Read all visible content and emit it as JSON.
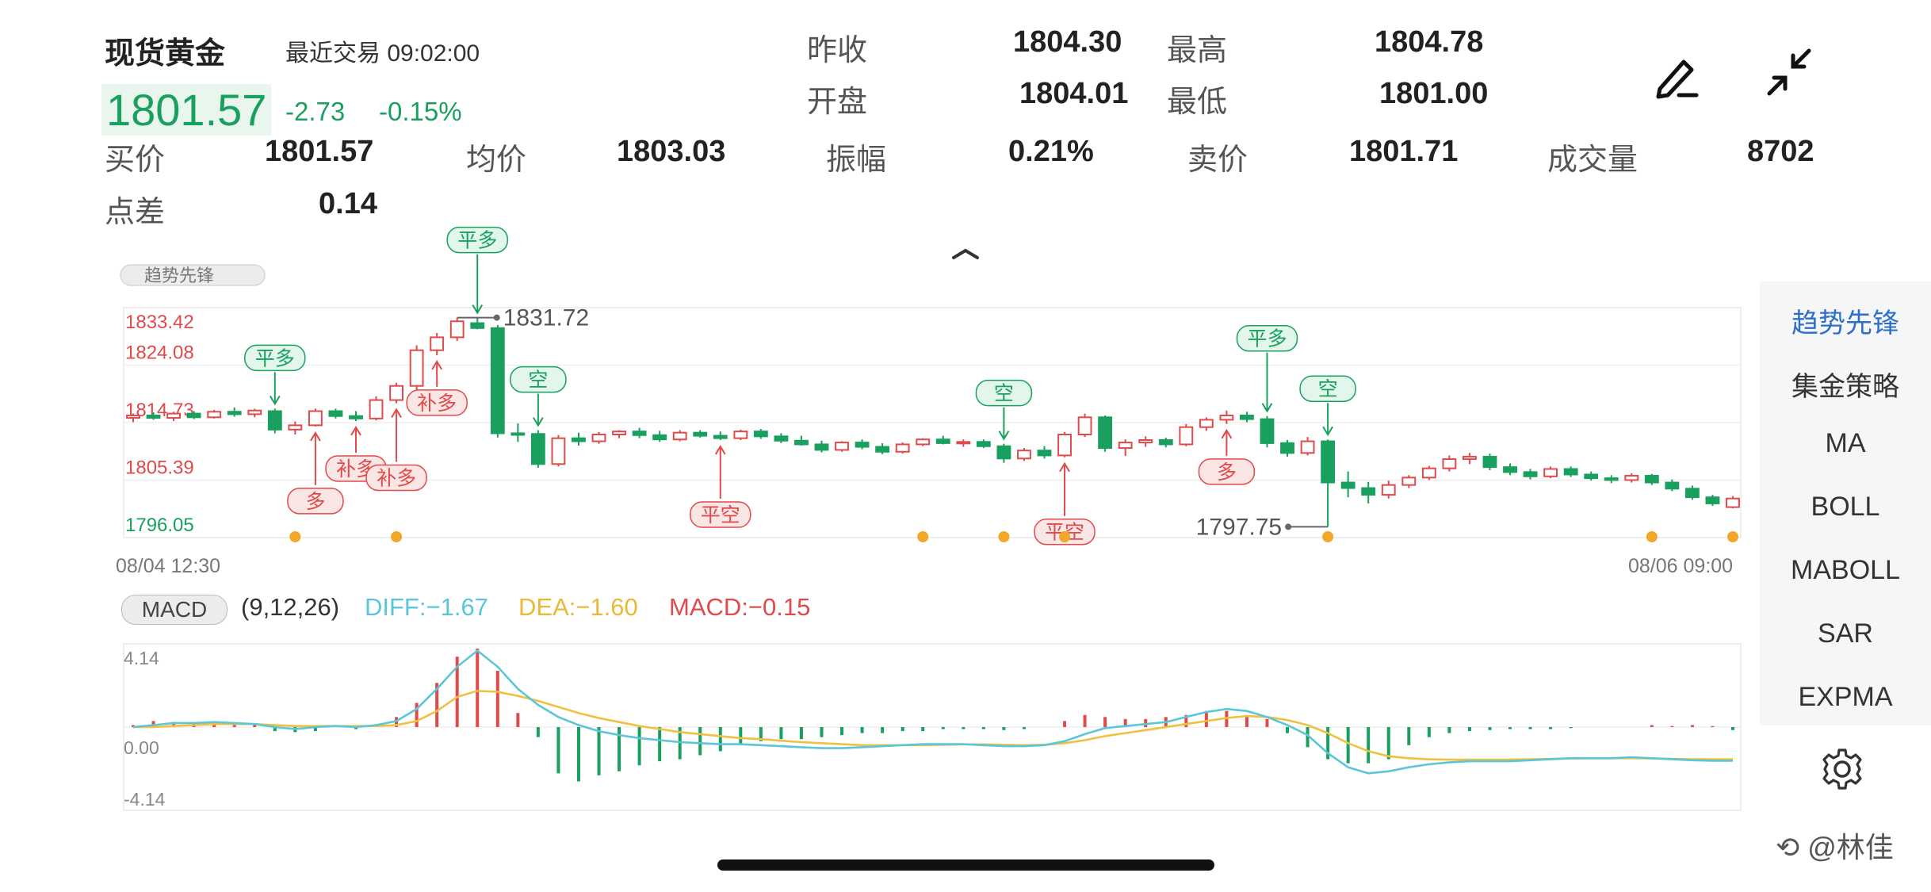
{
  "header": {
    "title": "现货黄金",
    "last_trade": "最近交易 09:02:00",
    "price": "1801.57",
    "change": "-2.73",
    "change_pct": "-0.15%",
    "prev_close_label": "昨收",
    "prev_close": "1804.30",
    "high_label": "最高",
    "high": "1804.78",
    "open_label": "开盘",
    "open": "1804.01",
    "low_label": "最低",
    "low": "1801.00",
    "bid_label": "买价",
    "bid": "1801.57",
    "avg_label": "均价",
    "avg": "1803.03",
    "amp_label": "振幅",
    "amp": "0.21%",
    "ask_label": "卖价",
    "ask": "1801.71",
    "volume_label": "成交量",
    "volume": "8702",
    "spread_label": "点差",
    "spread": "0.14"
  },
  "sidebar": {
    "items": [
      "趋势先锋",
      "集金策略",
      "MA",
      "BOLL",
      "MABOLL",
      "SAR",
      "EXPMA"
    ],
    "active_index": 0
  },
  "macd": {
    "pill": "MACD",
    "params": "(9,12,26)",
    "diff": "DIFF:−1.67",
    "dea": "DEA:−1.60",
    "macd": "MACD:−0.15"
  },
  "watermark": "@林佳",
  "colors": {
    "up": "#e04a4a",
    "down": "#1aa05e",
    "diff": "#5bc6d8",
    "dea": "#f0c040",
    "dot": "#f2a62a"
  },
  "chart_data": [
    {
      "type": "candlestick",
      "ylim": [
        1796.05,
        1833.42
      ],
      "ytick_labels": [
        "1833.42",
        "1824.08",
        "1814.73",
        "1805.39",
        "1796.05"
      ],
      "x_start_label": "08/04 12:30",
      "x_end_label": "08/06 09:00",
      "legend_tag": "趋势先锋",
      "max_label": "1831.72",
      "min_label": "1797.75",
      "candles": [
        [
          1815.5,
          1816.2,
          1814.8,
          1815.9
        ],
        [
          1815.9,
          1816.4,
          1815.2,
          1815.5
        ],
        [
          1815.5,
          1816.5,
          1815.0,
          1816.2
        ],
        [
          1816.2,
          1816.6,
          1815.3,
          1815.6
        ],
        [
          1815.6,
          1816.8,
          1815.4,
          1816.5
        ],
        [
          1816.5,
          1817.2,
          1815.7,
          1816.1
        ],
        [
          1816.1,
          1817.0,
          1815.6,
          1816.7
        ],
        [
          1816.6,
          1817.0,
          1813.0,
          1813.6
        ],
        [
          1813.6,
          1814.9,
          1812.8,
          1814.3
        ],
        [
          1814.3,
          1817.0,
          1814.1,
          1816.6
        ],
        [
          1816.6,
          1817.0,
          1815.4,
          1815.8
        ],
        [
          1815.8,
          1816.6,
          1815.0,
          1815.4
        ],
        [
          1815.4,
          1819.0,
          1815.1,
          1818.4
        ],
        [
          1818.4,
          1821.2,
          1817.9,
          1820.7
        ],
        [
          1820.7,
          1827.3,
          1820.0,
          1826.5
        ],
        [
          1826.5,
          1829.3,
          1825.7,
          1828.6
        ],
        [
          1828.6,
          1831.8,
          1828.0,
          1831.2
        ],
        [
          1830.9,
          1831.8,
          1829.9,
          1830.1
        ],
        [
          1830.1,
          1830.6,
          1812.3,
          1813.0
        ],
        [
          1813.0,
          1814.6,
          1811.6,
          1812.9
        ],
        [
          1812.9,
          1813.5,
          1807.4,
          1808.0
        ],
        [
          1808.0,
          1812.7,
          1807.6,
          1812.2
        ],
        [
          1812.2,
          1813.1,
          1811.0,
          1811.7
        ],
        [
          1811.7,
          1813.2,
          1811.3,
          1812.8
        ],
        [
          1812.8,
          1813.5,
          1812.2,
          1813.3
        ],
        [
          1813.3,
          1813.9,
          1812.2,
          1812.7
        ],
        [
          1812.7,
          1813.4,
          1811.6,
          1812.0
        ],
        [
          1812.0,
          1813.5,
          1811.7,
          1813.1
        ],
        [
          1813.1,
          1813.5,
          1812.3,
          1812.6
        ],
        [
          1812.6,
          1813.3,
          1811.9,
          1812.2
        ],
        [
          1812.2,
          1813.6,
          1811.9,
          1813.3
        ],
        [
          1813.3,
          1813.7,
          1812.1,
          1812.5
        ],
        [
          1812.5,
          1813.0,
          1811.4,
          1811.8
        ],
        [
          1811.8,
          1812.6,
          1811.0,
          1811.2
        ],
        [
          1811.2,
          1811.8,
          1809.9,
          1810.3
        ],
        [
          1810.3,
          1811.7,
          1810.0,
          1811.5
        ],
        [
          1811.5,
          1812.0,
          1810.4,
          1810.8
        ],
        [
          1810.8,
          1811.4,
          1809.6,
          1810.0
        ],
        [
          1810.0,
          1811.5,
          1809.7,
          1811.2
        ],
        [
          1811.2,
          1812.2,
          1810.9,
          1812.0
        ],
        [
          1812.0,
          1812.6,
          1811.2,
          1811.4
        ],
        [
          1811.4,
          1812.0,
          1810.8,
          1811.6
        ],
        [
          1811.6,
          1812.0,
          1810.6,
          1810.9
        ],
        [
          1810.9,
          1811.3,
          1808.2,
          1808.9
        ],
        [
          1808.9,
          1810.6,
          1808.5,
          1810.2
        ],
        [
          1810.2,
          1810.9,
          1808.9,
          1809.4
        ],
        [
          1809.4,
          1813.2,
          1809.1,
          1812.8
        ],
        [
          1812.8,
          1816.2,
          1812.4,
          1815.6
        ],
        [
          1815.6,
          1815.9,
          1810.0,
          1810.6
        ],
        [
          1810.6,
          1812.0,
          1809.3,
          1811.5
        ],
        [
          1811.5,
          1812.5,
          1810.8,
          1811.9
        ],
        [
          1811.9,
          1812.3,
          1810.7,
          1811.2
        ],
        [
          1811.2,
          1814.5,
          1810.9,
          1814.0
        ],
        [
          1814.0,
          1815.6,
          1813.4,
          1815.2
        ],
        [
          1815.2,
          1816.7,
          1814.5,
          1815.9
        ],
        [
          1815.9,
          1816.5,
          1814.8,
          1815.3
        ],
        [
          1815.3,
          1815.8,
          1810.7,
          1811.4
        ],
        [
          1811.4,
          1811.9,
          1809.2,
          1809.8
        ],
        [
          1809.8,
          1812.4,
          1809.4,
          1811.7
        ],
        [
          1811.7,
          1812.0,
          1797.8,
          1805.0
        ],
        [
          1805.0,
          1806.8,
          1802.6,
          1804.1
        ],
        [
          1804.1,
          1805.1,
          1801.6,
          1803.0
        ],
        [
          1803.0,
          1805.3,
          1802.4,
          1804.6
        ],
        [
          1804.6,
          1806.2,
          1804.1,
          1805.8
        ],
        [
          1805.8,
          1807.7,
          1805.4,
          1807.3
        ],
        [
          1807.3,
          1809.4,
          1806.8,
          1808.8
        ],
        [
          1808.8,
          1809.8,
          1808.0,
          1809.2
        ],
        [
          1809.2,
          1809.7,
          1807.0,
          1807.5
        ],
        [
          1807.5,
          1808.1,
          1806.2,
          1806.7
        ],
        [
          1806.7,
          1807.2,
          1805.5,
          1806.0
        ],
        [
          1806.0,
          1807.6,
          1805.7,
          1807.2
        ],
        [
          1807.2,
          1807.6,
          1805.9,
          1806.3
        ],
        [
          1806.3,
          1806.8,
          1805.3,
          1805.7
        ],
        [
          1805.7,
          1806.2,
          1804.9,
          1805.4
        ],
        [
          1805.4,
          1806.5,
          1805.0,
          1806.1
        ],
        [
          1806.1,
          1806.4,
          1804.6,
          1805.0
        ],
        [
          1805.0,
          1805.5,
          1803.6,
          1804.0
        ],
        [
          1804.0,
          1804.5,
          1802.2,
          1802.6
        ],
        [
          1802.6,
          1803.0,
          1801.2,
          1801.6
        ],
        [
          1801.0,
          1802.8,
          1800.8,
          1802.4
        ]
      ],
      "signals": [
        {
          "label": "平多",
          "index": 7,
          "kind": "close"
        },
        {
          "label": "多",
          "index": 9,
          "kind": "open"
        },
        {
          "label": "补多",
          "index": 11,
          "kind": "open"
        },
        {
          "label": "补多",
          "index": 13,
          "kind": "open"
        },
        {
          "label": "补多",
          "index": 15,
          "kind": "open"
        },
        {
          "label": "平多",
          "index": 17,
          "kind": "close"
        },
        {
          "label": "空",
          "index": 20,
          "kind": "close"
        },
        {
          "label": "平空",
          "index": 29,
          "kind": "open"
        },
        {
          "label": "空",
          "index": 43,
          "kind": "close"
        },
        {
          "label": "平空",
          "index": 46,
          "kind": "open"
        },
        {
          "label": "多",
          "index": 54,
          "kind": "open"
        },
        {
          "label": "平多",
          "index": 56,
          "kind": "close"
        },
        {
          "label": "空",
          "index": 59,
          "kind": "close"
        }
      ],
      "dots": [
        8,
        13,
        39,
        43,
        46,
        59,
        75,
        79
      ]
    },
    {
      "type": "macd",
      "params": "(9,12,26)",
      "ylim": [
        -4.14,
        4.14
      ],
      "ytick_labels": [
        "4.14",
        "0.00",
        "-4.14"
      ],
      "diff": [
        0.0,
        0.1,
        0.2,
        0.2,
        0.25,
        0.2,
        0.15,
        0.0,
        -0.1,
        0.0,
        0.05,
        0.0,
        0.1,
        0.3,
        0.9,
        1.9,
        3.0,
        3.8,
        3.0,
        1.9,
        1.1,
        0.5,
        0.1,
        -0.2,
        -0.4,
        -0.55,
        -0.65,
        -0.75,
        -0.8,
        -0.85,
        -0.85,
        -0.9,
        -0.95,
        -1.0,
        -1.05,
        -1.05,
        -1.0,
        -0.95,
        -0.9,
        -0.85,
        -0.85,
        -0.85,
        -0.9,
        -0.95,
        -0.95,
        -0.9,
        -0.7,
        -0.35,
        -0.05,
        0.05,
        0.15,
        0.25,
        0.5,
        0.75,
        0.9,
        0.8,
        0.5,
        0.1,
        -0.4,
        -1.3,
        -2.0,
        -2.3,
        -2.2,
        -2.0,
        -1.85,
        -1.75,
        -1.7,
        -1.7,
        -1.7,
        -1.65,
        -1.6,
        -1.55,
        -1.55,
        -1.55,
        -1.5,
        -1.55,
        -1.6,
        -1.65,
        -1.67,
        -1.67
      ],
      "dea": [
        0.0,
        0.0,
        0.05,
        0.1,
        0.15,
        0.15,
        0.15,
        0.1,
        0.05,
        0.05,
        0.05,
        0.05,
        0.05,
        0.1,
        0.3,
        0.8,
        1.5,
        1.8,
        1.75,
        1.55,
        1.3,
        1.0,
        0.7,
        0.45,
        0.25,
        0.05,
        -0.1,
        -0.25,
        -0.35,
        -0.45,
        -0.55,
        -0.6,
        -0.68,
        -0.75,
        -0.8,
        -0.85,
        -0.9,
        -0.9,
        -0.9,
        -0.9,
        -0.88,
        -0.86,
        -0.86,
        -0.88,
        -0.9,
        -0.88,
        -0.8,
        -0.65,
        -0.45,
        -0.3,
        -0.15,
        0.0,
        0.15,
        0.3,
        0.45,
        0.55,
        0.5,
        0.35,
        0.1,
        -0.3,
        -0.8,
        -1.2,
        -1.45,
        -1.55,
        -1.6,
        -1.62,
        -1.62,
        -1.62,
        -1.62,
        -1.6,
        -1.58,
        -1.56,
        -1.55,
        -1.55,
        -1.55,
        -1.56,
        -1.58,
        -1.6,
        -1.6,
        -1.6
      ],
      "macd": [
        0.1,
        0.3,
        0.25,
        0.2,
        0.25,
        0.2,
        0.1,
        -0.2,
        -0.25,
        -0.2,
        0.0,
        -0.1,
        0.1,
        0.5,
        1.2,
        2.2,
        3.5,
        3.9,
        2.8,
        0.7,
        -0.5,
        -2.3,
        -2.7,
        -2.4,
        -2.2,
        -1.9,
        -1.7,
        -1.6,
        -1.4,
        -1.2,
        -0.9,
        -0.7,
        -0.6,
        -0.6,
        -0.5,
        -0.4,
        -0.3,
        -0.3,
        -0.2,
        -0.2,
        -0.1,
        -0.1,
        -0.1,
        -0.15,
        -0.1,
        0.0,
        0.3,
        0.6,
        0.5,
        0.4,
        0.4,
        0.5,
        0.6,
        0.8,
        0.8,
        0.5,
        0.4,
        -0.3,
        -1.0,
        -1.6,
        -1.8,
        -1.8,
        -1.6,
        -0.9,
        -0.5,
        -0.3,
        -0.2,
        -0.15,
        -0.1,
        -0.1,
        -0.1,
        -0.05,
        0.0,
        0.0,
        0.0,
        0.1,
        0.05,
        0.1,
        0.05,
        -0.15
      ]
    }
  ]
}
